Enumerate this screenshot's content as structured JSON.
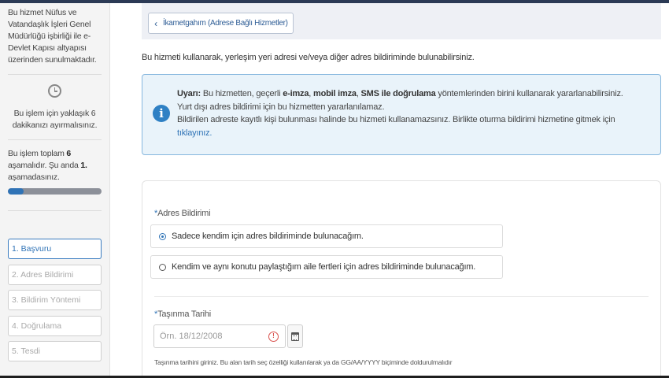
{
  "sidebar": {
    "service_info": "Bu hizmet Nüfus ve Vatandaşlık İşleri Genel Müdürlüğü işbirliği ile e-Devlet Kapısı altyapısı üzerinden sunulmaktadır.",
    "clock_icon": "clock-icon",
    "time_info": "Bu işlem için yaklaşık 6 dakikanızı ayırmalısınız.",
    "steps_info_prefix": "Bu işlem toplam ",
    "steps_total": "6",
    "steps_info_middle": " aşamalıdır. Şu anda ",
    "steps_current": "1.",
    "steps_info_suffix": " aşamadasınız.",
    "progress_fraction": 0.1667,
    "steps": [
      {
        "label": "1. Başvuru",
        "active": true
      },
      {
        "label": "2. Adres Bildirimi",
        "active": false
      },
      {
        "label": "3. Bildirim Yöntemi",
        "active": false
      },
      {
        "label": "4. Doğrulama",
        "active": false
      },
      {
        "label": "5. Tesdi",
        "active": false
      }
    ]
  },
  "breadcrumb": {
    "chevron_icon": "chevron-left-icon",
    "label": "İkametgahım (Adrese Bağlı Hizmetler)"
  },
  "intro_text": "Bu hizmeti kullanarak, yerleşim yeri adresi ve/veya diğer adres bildiriminde bulunabilirsiniz.",
  "alert": {
    "icon": "info-icon",
    "warning_label": "Uyarı:",
    "line1_a": " Bu hizmetten, geçerli ",
    "line1_b": "e-imza",
    "line1_c": ", ",
    "line1_d": "mobil imza",
    "line1_e": ", ",
    "line1_f": "SMS ile doğrulama",
    "line1_g": " yöntemlerinden birini kullanarak yararlanabilirsiniz.",
    "line2": "Yurt dışı adres bildirimi için bu hizmetten yararlanılamaz.",
    "line3": "Bildirilen adreste kayıtlı kişi bulunması halinde bu hizmeti kullanamazsınız. Birlikte oturma bildirimi hizmetine gitmek için",
    "link": "tıklayınız."
  },
  "form": {
    "required_mark": "*",
    "address_label": "Adres Bildirimi",
    "options": [
      {
        "label": "Sadece kendim için adres bildiriminde bulunacağım.",
        "selected": true
      },
      {
        "label": "Kendim ve aynı konutu paylaştığım aile fertleri için adres bildiriminde bulunacağım.",
        "selected": false
      }
    ],
    "date_label": "Taşınma Tarihi",
    "date_placeholder": "Örn. 18/12/2008",
    "date_value": "",
    "warning_icon": "warning-icon",
    "warning_glyph": "!",
    "calendar_icon": "calendar-icon",
    "date_hint": "Taşınma tarihini giriniz. Bu alan tarih seç özelliği kullanılarak ya da GG/AA/YYYY biçiminde doldurulmalıdır"
  },
  "colors": {
    "accent": "#2f73b6",
    "alert_bg": "#e9f3fa",
    "alert_border": "#86b7de",
    "warning": "#d9534f"
  }
}
